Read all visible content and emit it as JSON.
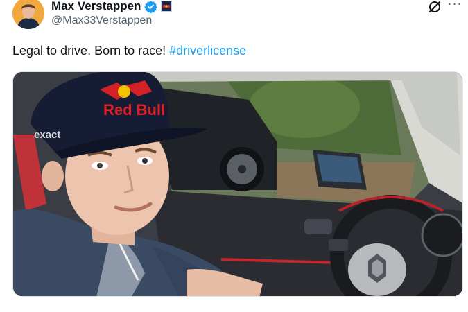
{
  "author": {
    "display_name": "Max Verstappen",
    "handle": "@Max33Verstappen",
    "verified": true,
    "avatar_icon": "profile-avatar"
  },
  "actions": {
    "grok_icon": "grok-icon",
    "more_icon": "more-options-icon",
    "more_glyph": "···"
  },
  "tweet": {
    "text": "Legal to drive. Born to race! ",
    "hashtag": "#driverlicense"
  },
  "media": {
    "cap_brand_1": "Red Bull",
    "cap_brand_2": "exact"
  },
  "colors": {
    "link": "#1d9bf0",
    "verified": "#1d9bf0",
    "text": "#0f1419",
    "secondary": "#536471"
  }
}
